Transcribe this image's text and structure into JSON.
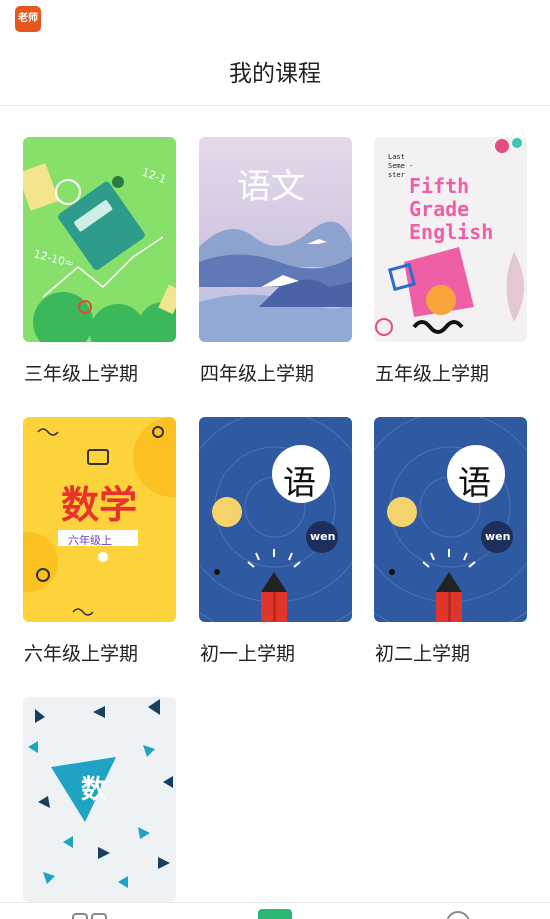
{
  "app": {
    "icon_text": "老师"
  },
  "header": {
    "title": "我的课程"
  },
  "courses": [
    {
      "label": "三年级上学期",
      "cover": "math-notebook-cover"
    },
    {
      "label": "四年级上学期",
      "cover": "chinese-landscape-cover",
      "cover_text": "语文"
    },
    {
      "label": "五年级上学期",
      "cover": "english-memphis-cover",
      "cover_text": [
        "Fifth",
        "Grade",
        "English"
      ],
      "cover_small": [
        "Last",
        "Seme -",
        "ster"
      ]
    },
    {
      "label": "六年级上学期",
      "cover": "math-yellow-cover",
      "cover_text": "数学",
      "cover_sub": "六年级上"
    },
    {
      "label": "初一上学期",
      "cover": "chinese-pencil-cover",
      "cover_text": "语",
      "cover_badge": "wen"
    },
    {
      "label": "初二上学期",
      "cover": "chinese-pencil-cover",
      "cover_text": "语",
      "cover_badge": "wen"
    },
    {
      "label": "",
      "cover": "math-triangle-cover",
      "cover_text": "数"
    }
  ],
  "colors": {
    "accent": "#2bb673",
    "header_text": "#222222"
  }
}
